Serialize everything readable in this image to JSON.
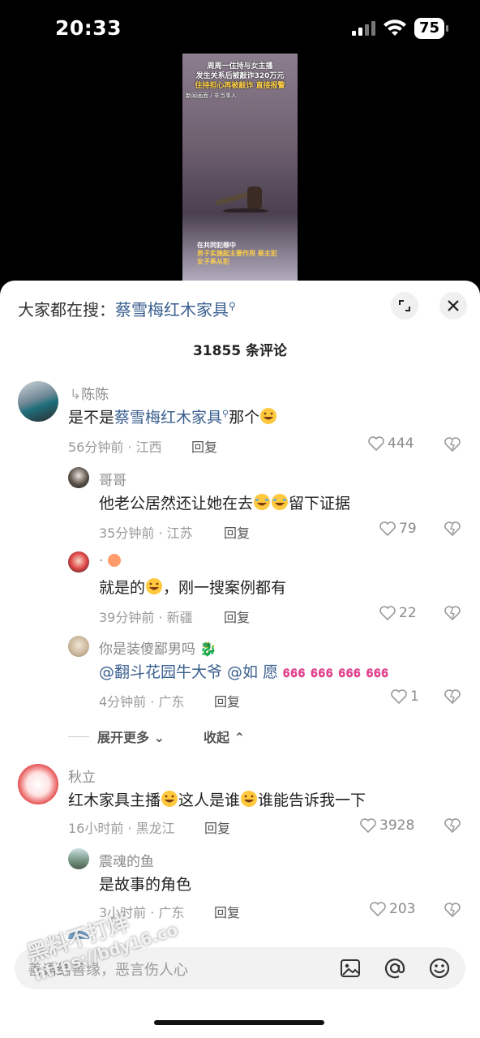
{
  "status_bar": {
    "time": "20:33",
    "battery": "75"
  },
  "video": {
    "caption_line1": "周周一住持与女主播",
    "caption_line2": "发生关系后被敲诈320万元",
    "caption_line3": "住持担心再被敲诈 直接报警",
    "caption_line4": "新闻画面 / 非当事人",
    "sub_line1": "在共同犯罪中",
    "sub_line2": "男子实施起主要作用 是主犯",
    "sub_line3": "女子系从犯"
  },
  "sheet": {
    "search_prefix": "大家都在搜：",
    "search_term": "蔡雪梅红木家具",
    "comment_count": "31855 条评论"
  },
  "comments": [
    {
      "name": "陈陈",
      "text_prefix": "是不是",
      "text_link": "蔡雪梅红木家具",
      "text_suffix": "那个",
      "meta": "56分钟前 · 江西",
      "reply": "回复",
      "likes": "444"
    },
    {
      "name": "哥哥",
      "text_a": "他老公居然还让她在去",
      "text_b": "留下证据",
      "meta": "35分钟前 · 江苏",
      "reply": "回复",
      "likes": "79"
    },
    {
      "name": "·",
      "text_a": "就是的",
      "text_b": "，刚一搜案例都有",
      "meta": "39分钟前 · 新疆",
      "reply": "回复",
      "likes": "22"
    },
    {
      "name": "你是装傻鄙男吗",
      "text_a": "@翻斗花园牛大爷 @如 愿",
      "meta": "4分钟前 · 广东",
      "reply": "回复",
      "likes": "1"
    },
    {
      "name": "秋立",
      "text_a": "红木家具主播",
      "text_b": "这人是谁",
      "text_c": "谁能告诉我一下",
      "meta": "16小时前 · 黑龙江",
      "reply": "回复",
      "likes": "3928"
    },
    {
      "name": "震魂的鱼",
      "text_a": "是故事的角色",
      "meta": "3小时前 · 广东",
      "reply": "回复",
      "likes": "203"
    }
  ],
  "expand": {
    "more": "展开更多",
    "collapse": "收起"
  },
  "input": {
    "placeholder": "善语结善缘，恶言伤人心"
  },
  "watermark": {
    "line1": "黑料不打烊",
    "line2": "https://bdy16.co"
  }
}
